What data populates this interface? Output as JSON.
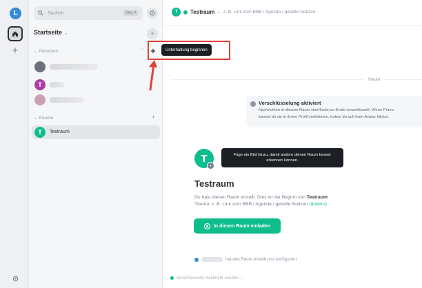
{
  "rail": {
    "user_initial": "L"
  },
  "search": {
    "placeholder": "Suchen",
    "shortcut": "Strg K"
  },
  "space": {
    "title": "Startseite",
    "add": "+"
  },
  "sections": {
    "people": "Personen",
    "rooms": "Räume"
  },
  "dms": [
    {
      "initial": "",
      "color": "#6b7078"
    },
    {
      "initial": "T",
      "color": "#ac3ba8"
    },
    {
      "initial": "",
      "color": "#c9a0b6"
    }
  ],
  "rooms": [
    {
      "initial": "T",
      "name": "Testraum"
    }
  ],
  "tooltip_start_chat": "Unterhaltung beginnen",
  "header": {
    "initial": "T",
    "title": "Testraum",
    "topic": "z. B. Link zum BBB / Agenda / geteilte Notizen"
  },
  "timeline": {
    "day_label": "Heute",
    "encryption_title": "Verschlüsselung aktiviert",
    "encryption_line1": "Nachrichten in diesem Raum sind Ende-zu-Ende-verschlüsselt. Wenn Perso",
    "encryption_line2": "kannst du sie in ihrem Profil verifizieren, indem du auf ihren Avatar klickst.",
    "avatar_tooltip": "Füge ein Bild hinzu, damit andere deinen Raum besser erkennen können.",
    "room_initial": "T",
    "room_name": "Testraum",
    "intro_prefix": "Du hast diesen Raum erstellt. Dies ist der Beginn von ",
    "intro_room": "Testraum",
    "intro_suffix": ".",
    "topic_prefix": "Thema: z. B. Link zum BBB / Agenda / geteilte Notizen ",
    "topic_edit": "(ändern)",
    "invite_label": "In diesen Raum einladen",
    "event_text": "hat den Raum erstellt und konfiguriert."
  },
  "composer": {
    "placeholder": "Verschlüsselte Nachricht senden…"
  },
  "colors": {
    "accent": "#0dbd8b",
    "highlight": "#e0403b",
    "tooltip_bg": "#1c1f24"
  }
}
